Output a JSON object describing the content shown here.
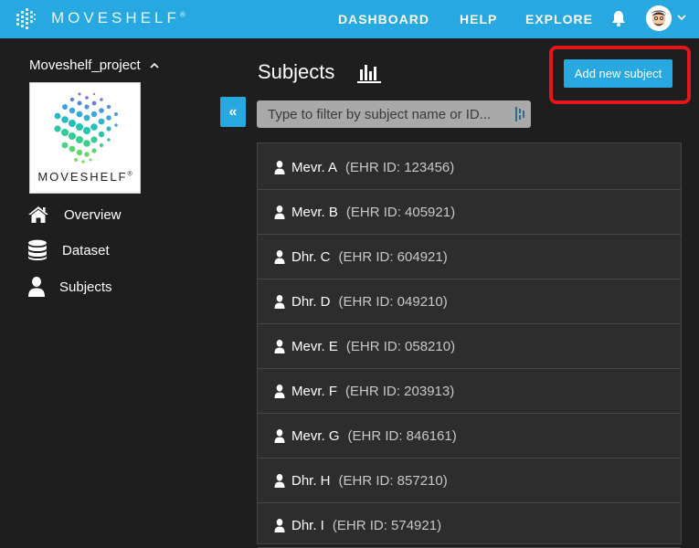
{
  "topbar": {
    "brand": "MOVESHELF",
    "brand_reg": "®",
    "nav": [
      "DASHBOARD",
      "HELP",
      "EXPLORE"
    ],
    "icons": {
      "logo": "moveshelf-logo-icon",
      "bell": "bell-icon",
      "avatar": "user-avatar",
      "caret": "chevron-down-icon"
    }
  },
  "sidebar": {
    "project_name": "Moveshelf_project",
    "logo_text": "MOVESHELF",
    "logo_reg": "®",
    "items": [
      {
        "label": "Overview",
        "icon": "home-icon"
      },
      {
        "label": "Dataset",
        "icon": "database-icon"
      },
      {
        "label": "Subjects",
        "icon": "user-icon"
      }
    ]
  },
  "main": {
    "collapse_label": "«",
    "title": "Subjects",
    "add_button": "Add new subject",
    "filter_placeholder": "Type to filter by subject name or ID...",
    "subjects": [
      {
        "name": "Mevr. A",
        "ehr": "(EHR ID: 123456)"
      },
      {
        "name": "Mevr. B",
        "ehr": "(EHR ID: 405921)"
      },
      {
        "name": "Dhr. C",
        "ehr": "(EHR ID: 604921)"
      },
      {
        "name": "Dhr. D",
        "ehr": "(EHR ID: 049210)"
      },
      {
        "name": "Mevr. E",
        "ehr": "(EHR ID: 058210)"
      },
      {
        "name": "Mevr. F",
        "ehr": "(EHR ID: 203913)"
      },
      {
        "name": "Mevr. G",
        "ehr": "(EHR ID: 846161)"
      },
      {
        "name": "Dhr. H",
        "ehr": "(EHR ID: 857210)"
      },
      {
        "name": "Dhr. I",
        "ehr": "(EHR ID: 574921)"
      }
    ]
  },
  "colors": {
    "accent": "#27a8e0",
    "highlight": "#e3161a",
    "background": "#1e1e1e"
  }
}
